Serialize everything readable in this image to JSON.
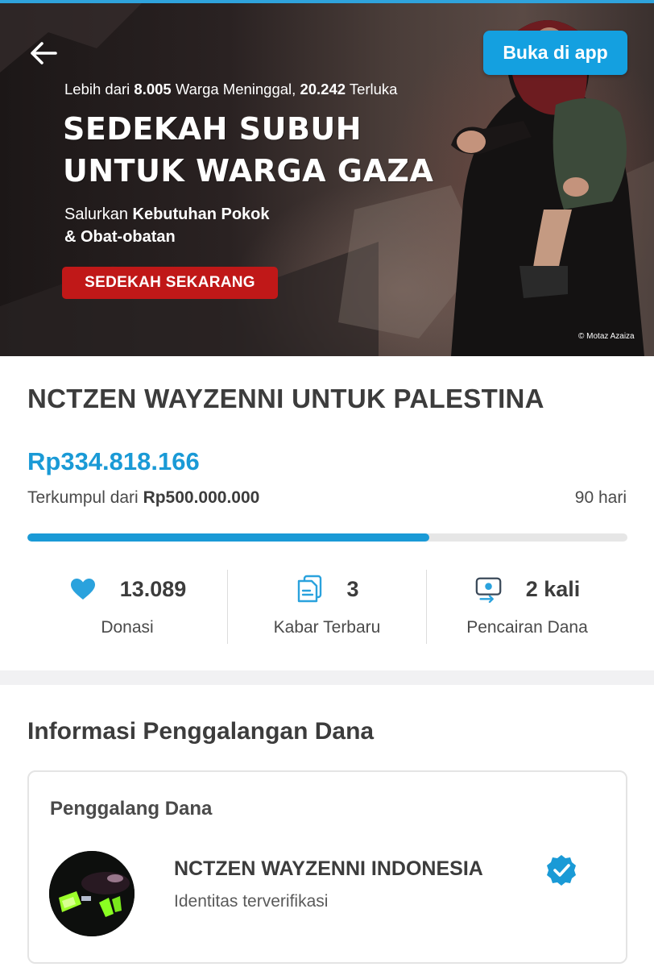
{
  "header": {
    "open_app_label": "Buka di app"
  },
  "banner": {
    "stats_line": {
      "part1": "Lebih dari ",
      "deaths": "8.005",
      "part2": " Warga Meninggal, ",
      "injured": "20.242",
      "part3": " Terluka"
    },
    "title_line1": "SEDEKAH SUBUH",
    "title_line2": "UNTUK WARGA GAZA",
    "desc_line1_prefix": "Salurkan ",
    "desc_line1_bold": "Kebutuhan Pokok",
    "desc_line2_bold": "& Obat-obatan",
    "cta_label": "SEDEKAH SEKARANG",
    "photo_credit": "© Motaz Azaiza"
  },
  "campaign": {
    "title": "NCTZEN WAYZENNI UNTUK PALESTINA",
    "amount_collected": "Rp334.818.166",
    "target_prefix": "Terkumpul dari ",
    "target_amount": "Rp500.000.000",
    "days_left": "90 hari",
    "progress_fraction": 0.67
  },
  "stats": [
    {
      "icon": "heart-icon",
      "value": "13.089",
      "label": "Donasi"
    },
    {
      "icon": "news-updates-icon",
      "value": "3",
      "label": "Kabar Terbaru"
    },
    {
      "icon": "disbursement-icon",
      "value": "2 kali",
      "label": "Pencairan Dana"
    }
  ],
  "fundraising_info": {
    "section_title": "Informasi Penggalangan Dana",
    "organizer_heading": "Penggalang Dana",
    "organizer_name": "NCTZEN WAYZENNI INDONESIA",
    "organizer_status": "Identitas terverifikasi"
  },
  "colors": {
    "accent": "#1a9ad6",
    "button_blue": "#14a0e0",
    "cta_red": "#c01818",
    "progress_track": "#e6e6e6"
  }
}
